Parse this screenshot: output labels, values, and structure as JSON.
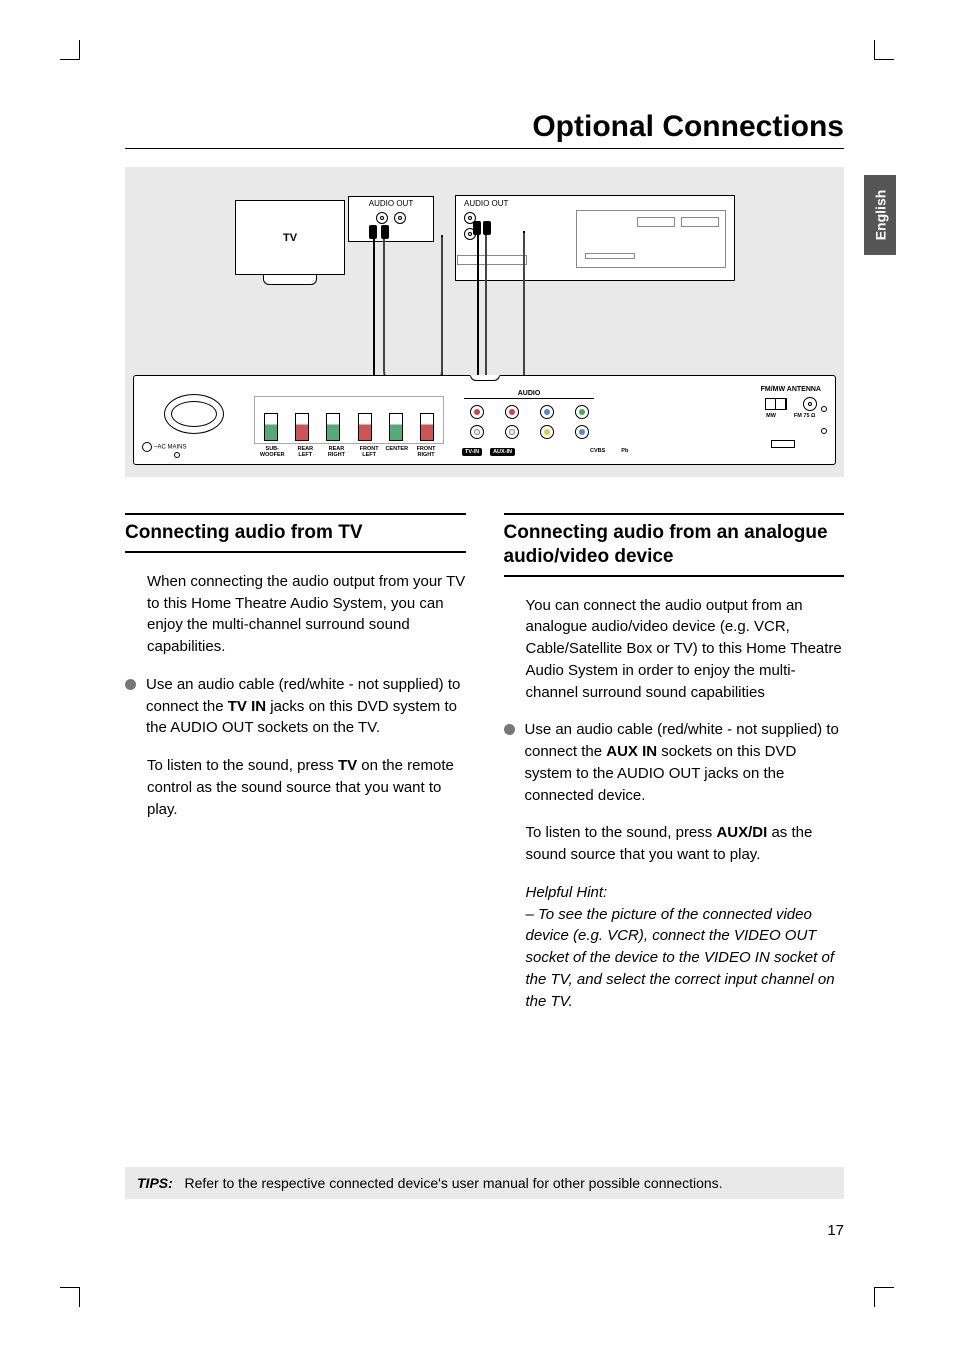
{
  "page": {
    "title": "Optional Connections",
    "language_tab": "English",
    "number": "17"
  },
  "diagram": {
    "tv_label": "TV",
    "tv_audio_out": "AUDIO OUT",
    "ext_audio_out": "AUDIO OUT",
    "receiver": {
      "ac_label": "~AC MAINS",
      "speaker_labels": [
        "SUB-WOOFER",
        "REAR LEFT",
        "REAR RIGHT",
        "FRONT LEFT",
        "CENTER",
        "FRONT RIGHT"
      ],
      "audio_header": "AUDIO",
      "io_labels": [
        "TV-IN",
        "AUX-IN"
      ],
      "video_labels": [
        "CVBS",
        "Pb"
      ],
      "antenna_header": "FM/MW ANTENNA",
      "antenna_sub": [
        "MW",
        "FM 75 Ω"
      ]
    }
  },
  "left": {
    "heading": "Connecting audio from TV",
    "p1": "When connecting the audio output from your TV to this Home Theatre Audio System, you can enjoy the multi-channel surround sound capabilities.",
    "bullet_pre": "Use an audio cable (red/white - not supplied) to connect the ",
    "bullet_bold": "TV IN",
    "bullet_post": " jacks on this DVD system to the AUDIO OUT sockets on the TV.",
    "p2_pre": "To listen to the sound, press ",
    "p2_bold": "TV",
    "p2_post": " on the remote control as the sound source that you want to play."
  },
  "right": {
    "heading": "Connecting audio from an analogue audio/video device",
    "p1": "You can connect the audio output from an analogue audio/video device (e.g. VCR, Cable/Satellite Box or TV) to this Home Theatre Audio System in order to enjoy the multi-channel surround sound capabilities",
    "bullet_pre": "Use an audio cable (red/white - not supplied) to connect the ",
    "bullet_bold": "AUX IN",
    "bullet_post": " sockets on this DVD system to the AUDIO OUT jacks on the connected device.",
    "p2_pre": "To listen to the sound, press ",
    "p2_bold": "AUX/DI",
    "p2_post": " as the sound source that you want to play.",
    "hint_label": "Helpful Hint:",
    "hint_body": "–  To see the picture of the connected video device (e.g. VCR), connect the VIDEO OUT socket of the device to the VIDEO IN socket of the TV, and select the correct input channel on the TV."
  },
  "tips": {
    "label": "TIPS:",
    "text": "Refer to the respective connected device's user manual for other possible connections."
  }
}
